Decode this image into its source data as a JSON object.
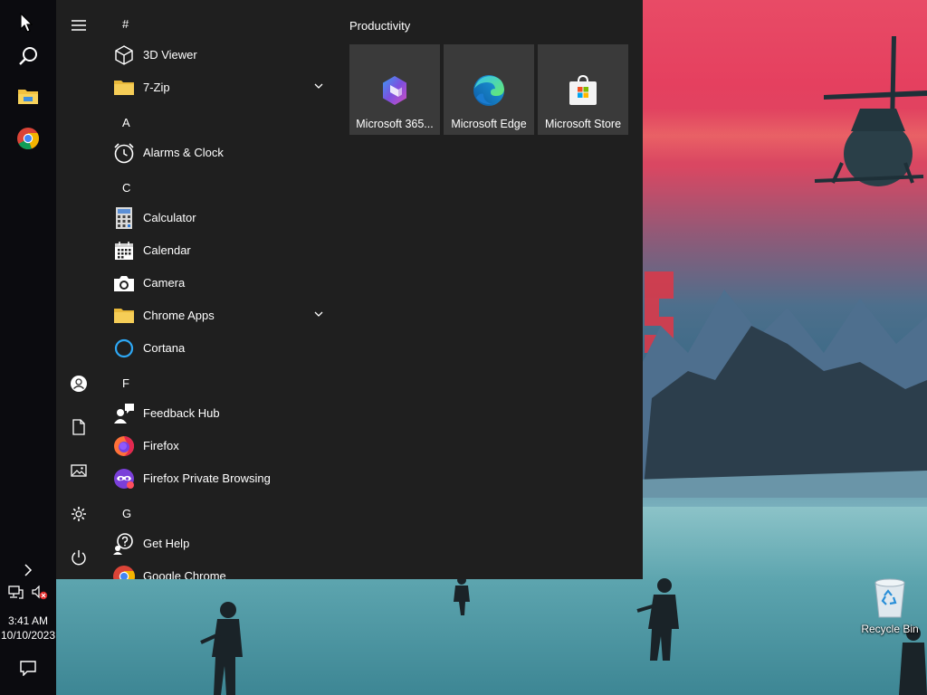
{
  "taskbar": {
    "start_icon": "windows-logo-icon",
    "search_icon": "search-icon",
    "pinned": [
      {
        "name": "file-explorer-icon"
      },
      {
        "name": "chrome-icon"
      }
    ],
    "tray_expand_icon": "chevron-right-icon",
    "network_icon": "network-icon",
    "volume_icon": "volume-muted-icon",
    "time": "3:41 AM",
    "date": "10/10/2023",
    "action_center_icon": "notification-icon"
  },
  "start_menu": {
    "hamburger_icon": "hamburger-menu-icon",
    "rail": [
      {
        "name": "user-account-icon"
      },
      {
        "name": "documents-icon"
      },
      {
        "name": "pictures-icon"
      },
      {
        "name": "settings-icon"
      },
      {
        "name": "power-icon"
      }
    ],
    "app_list": {
      "sections": [
        {
          "letter": "#",
          "apps": [
            {
              "label": "3D Viewer",
              "icon": "3d-viewer-icon"
            },
            {
              "label": "7-Zip",
              "icon": "folder-icon",
              "expandable": true
            }
          ]
        },
        {
          "letter": "A",
          "apps": [
            {
              "label": "Alarms & Clock",
              "icon": "alarm-clock-icon"
            }
          ]
        },
        {
          "letter": "C",
          "apps": [
            {
              "label": "Calculator",
              "icon": "calculator-icon"
            },
            {
              "label": "Calendar",
              "icon": "calendar-icon"
            },
            {
              "label": "Camera",
              "icon": "camera-icon"
            },
            {
              "label": "Chrome Apps",
              "icon": "folder-icon",
              "expandable": true
            },
            {
              "label": "Cortana",
              "icon": "cortana-icon"
            }
          ]
        },
        {
          "letter": "F",
          "apps": [
            {
              "label": "Feedback Hub",
              "icon": "feedback-hub-icon"
            },
            {
              "label": "Firefox",
              "icon": "firefox-icon"
            },
            {
              "label": "Firefox Private Browsing",
              "icon": "firefox-private-icon"
            }
          ]
        },
        {
          "letter": "G",
          "apps": [
            {
              "label": "Get Help",
              "icon": "get-help-icon"
            },
            {
              "label": "Google Chrome",
              "icon": "chrome-icon"
            }
          ]
        }
      ]
    },
    "tiles": {
      "group_title": "Productivity",
      "items": [
        {
          "label": "Microsoft 365...",
          "icon": "microsoft-365-icon"
        },
        {
          "label": "Microsoft Edge",
          "icon": "edge-icon"
        },
        {
          "label": "Microsoft Store",
          "icon": "store-icon"
        }
      ]
    }
  },
  "desktop": {
    "recycle_bin_label": "Recycle Bin",
    "recycle_bin_icon": "recycle-bin-icon"
  },
  "colors": {
    "start_bg": "#1f1f1f",
    "tile_bg": "#3a3a3a",
    "taskbar_bg": "#0b0b0f"
  }
}
